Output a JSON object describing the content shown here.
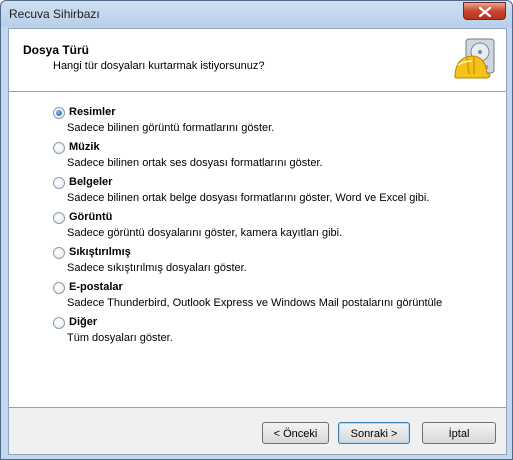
{
  "window": {
    "title": "Recuva Sihirbazı"
  },
  "header": {
    "title": "Dosya Türü",
    "subtitle": "Hangi tür dosyaları kurtarmak istiyorsunuz?"
  },
  "options": [
    {
      "label": "Resimler",
      "description": "Sadece bilinen görüntü formatlarını göster.",
      "checked": true
    },
    {
      "label": "Müzik",
      "description": "Sadece bilinen ortak ses dosyası formatlarını göster.",
      "checked": false
    },
    {
      "label": "Belgeler",
      "description": "Sadece bilinen ortak belge dosyası formatlarını göster, Word ve Excel gibi.",
      "checked": false
    },
    {
      "label": "Görüntü",
      "description": "Sadece görüntü dosyalarını göster, kamera kayıtları gibi.",
      "checked": false
    },
    {
      "label": "Sıkıştırılmış",
      "description": "Sadece sıkıştırılmış dosyaları göster.",
      "checked": false
    },
    {
      "label": "E-postalar",
      "description": "Sadece Thunderbird, Outlook Express ve Windows Mail postalarını görüntüle",
      "checked": false
    },
    {
      "label": "Diğer",
      "description": "Tüm dosyaları göster.",
      "checked": false
    }
  ],
  "buttons": {
    "back": "< Önceki",
    "next": "Sonraki >",
    "cancel": "İptal"
  },
  "icons": {
    "close": "close-icon",
    "logo": "hard-drive-helmet-icon"
  }
}
